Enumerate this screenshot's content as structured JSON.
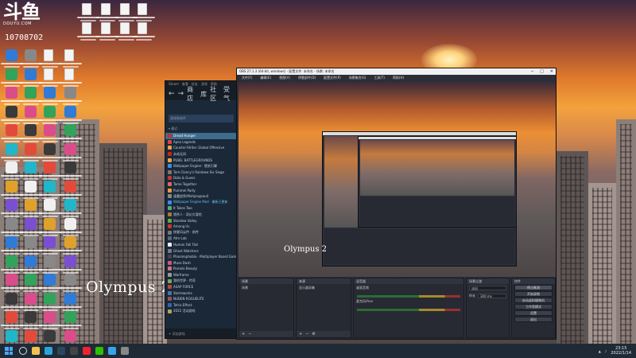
{
  "overlay": {
    "logo_mark": "斗鱼",
    "logo_sub": "DOUYU.COM",
    "room_number": "10708702"
  },
  "wallpaper": {
    "caption": "Olympus 2"
  },
  "steam": {
    "nav": {
      "back": "←",
      "forward": "→",
      "store": "商店",
      "library": "库",
      "community": "社区",
      "profile": "受气"
    },
    "menu": [
      "Steam",
      "查看",
      "好友",
      "游戏",
      "帮助"
    ],
    "search_placeholder": "游戏和软件",
    "section_recent": "▾ 最近",
    "games": [
      {
        "name": "Dread Hunger",
        "color": "#b33",
        "selected": true
      },
      {
        "name": "Apex Legends",
        "color": "#d44"
      },
      {
        "name": "Counter-Strike: Global Offensive",
        "color": "#e8a33a"
      },
      {
        "name": "永劫无间",
        "color": "#c22"
      },
      {
        "name": "PUBG: BATTLEGROUNDS",
        "color": "#e5a93b"
      },
      {
        "name": "Wallpaper Engine：壁纸引擎",
        "color": "#3b8de8"
      },
      {
        "name": "Tom Clancy's Rainbow Six Siege",
        "color": "#777"
      },
      {
        "name": "Dota & Guess",
        "color": "#c33"
      },
      {
        "name": "Tame Together",
        "color": "#d66"
      },
      {
        "name": "Pummel Party",
        "color": "#e94"
      },
      {
        "name": "逢魔战争(Mahjongsoul)",
        "color": "#888"
      },
      {
        "name": "Wallpaper Engine Mod · 最新已更新",
        "color": "#3b8de8",
        "blue": true
      },
      {
        "name": "It Takes Two",
        "color": "#5a8"
      },
      {
        "name": "猎杀人 · 奇幻大冒险",
        "color": "#a73"
      },
      {
        "name": "Stardew Valley",
        "color": "#6a4"
      },
      {
        "name": "Among Us",
        "color": "#c33"
      },
      {
        "name": "侠客风云传 · 前传",
        "color": "#777"
      },
      {
        "name": "Atm Lab",
        "color": "#567"
      },
      {
        "name": "Human Fall Flat",
        "color": "#eee"
      },
      {
        "name": "Ghost Watchers",
        "color": "#779"
      },
      {
        "name": "Phasmophobia · Multiplayer Board Game",
        "color": "#444"
      },
      {
        "name": "Muse Dash",
        "color": "#c58"
      },
      {
        "name": "Pomelo Beauty",
        "color": "#c77"
      },
      {
        "name": "Warframe",
        "color": "#999"
      },
      {
        "name": "我的世界 · 传奇",
        "color": "#7a5"
      },
      {
        "name": "ASAP FORCE",
        "color": "#b44"
      },
      {
        "name": "Stormworks",
        "color": "#47a"
      },
      {
        "name": "NUDEN ROGUELITE",
        "color": "#955"
      },
      {
        "name": "Tetris Effect",
        "color": "#36a"
      },
      {
        "name": "2022 活动游戏",
        "color": "#aa5"
      }
    ],
    "add_game": "+ 添加游戏"
  },
  "obs": {
    "title": "OBS 27.1.3 (64-bit, windows) - 配置文件: 未命名 - 场景: 未命名",
    "window_controls": [
      "─",
      "□",
      "✕"
    ],
    "menu": [
      "文件(F)",
      "编辑(E)",
      "视图(V)",
      "停靠部件(D)",
      "配置文件(P)",
      "场景集合(S)",
      "工具(T)",
      "帮助(H)"
    ],
    "preview_caption": "Olympus 2",
    "docks": {
      "scenes": {
        "title": "场景",
        "items": [
          "场景"
        ]
      },
      "sources": {
        "title": "来源",
        "items": [
          "显示器采集"
        ]
      },
      "mixer": {
        "title": "混音器",
        "tracks": [
          "桌面音频",
          "麦克风/Aux"
        ]
      },
      "transitions": {
        "title": "场景过渡",
        "mode": "淡出",
        "duration_label": "时长",
        "duration": "300 ms"
      },
      "controls": {
        "title": "控件",
        "buttons": [
          "停止推流",
          "开始录制",
          "启动虚拟摄像机",
          "工作室模式",
          "设置",
          "退出"
        ]
      }
    }
  },
  "taskbar": {
    "time": "23:15",
    "date": "2022/1/14",
    "apps": [
      {
        "name": "explorer-icon",
        "color": "#f2c14e"
      },
      {
        "name": "edge-icon",
        "color": "#2aa4d8"
      },
      {
        "name": "steam-icon",
        "color": "#2a475e"
      },
      {
        "name": "obs-icon",
        "color": "#444"
      },
      {
        "name": "netease-music-icon",
        "color": "#e23"
      },
      {
        "name": "wechat-icon",
        "color": "#2dc100"
      },
      {
        "name": "qq-icon",
        "color": "#38a3e8"
      },
      {
        "name": "settings-icon",
        "color": "#888"
      }
    ]
  }
}
